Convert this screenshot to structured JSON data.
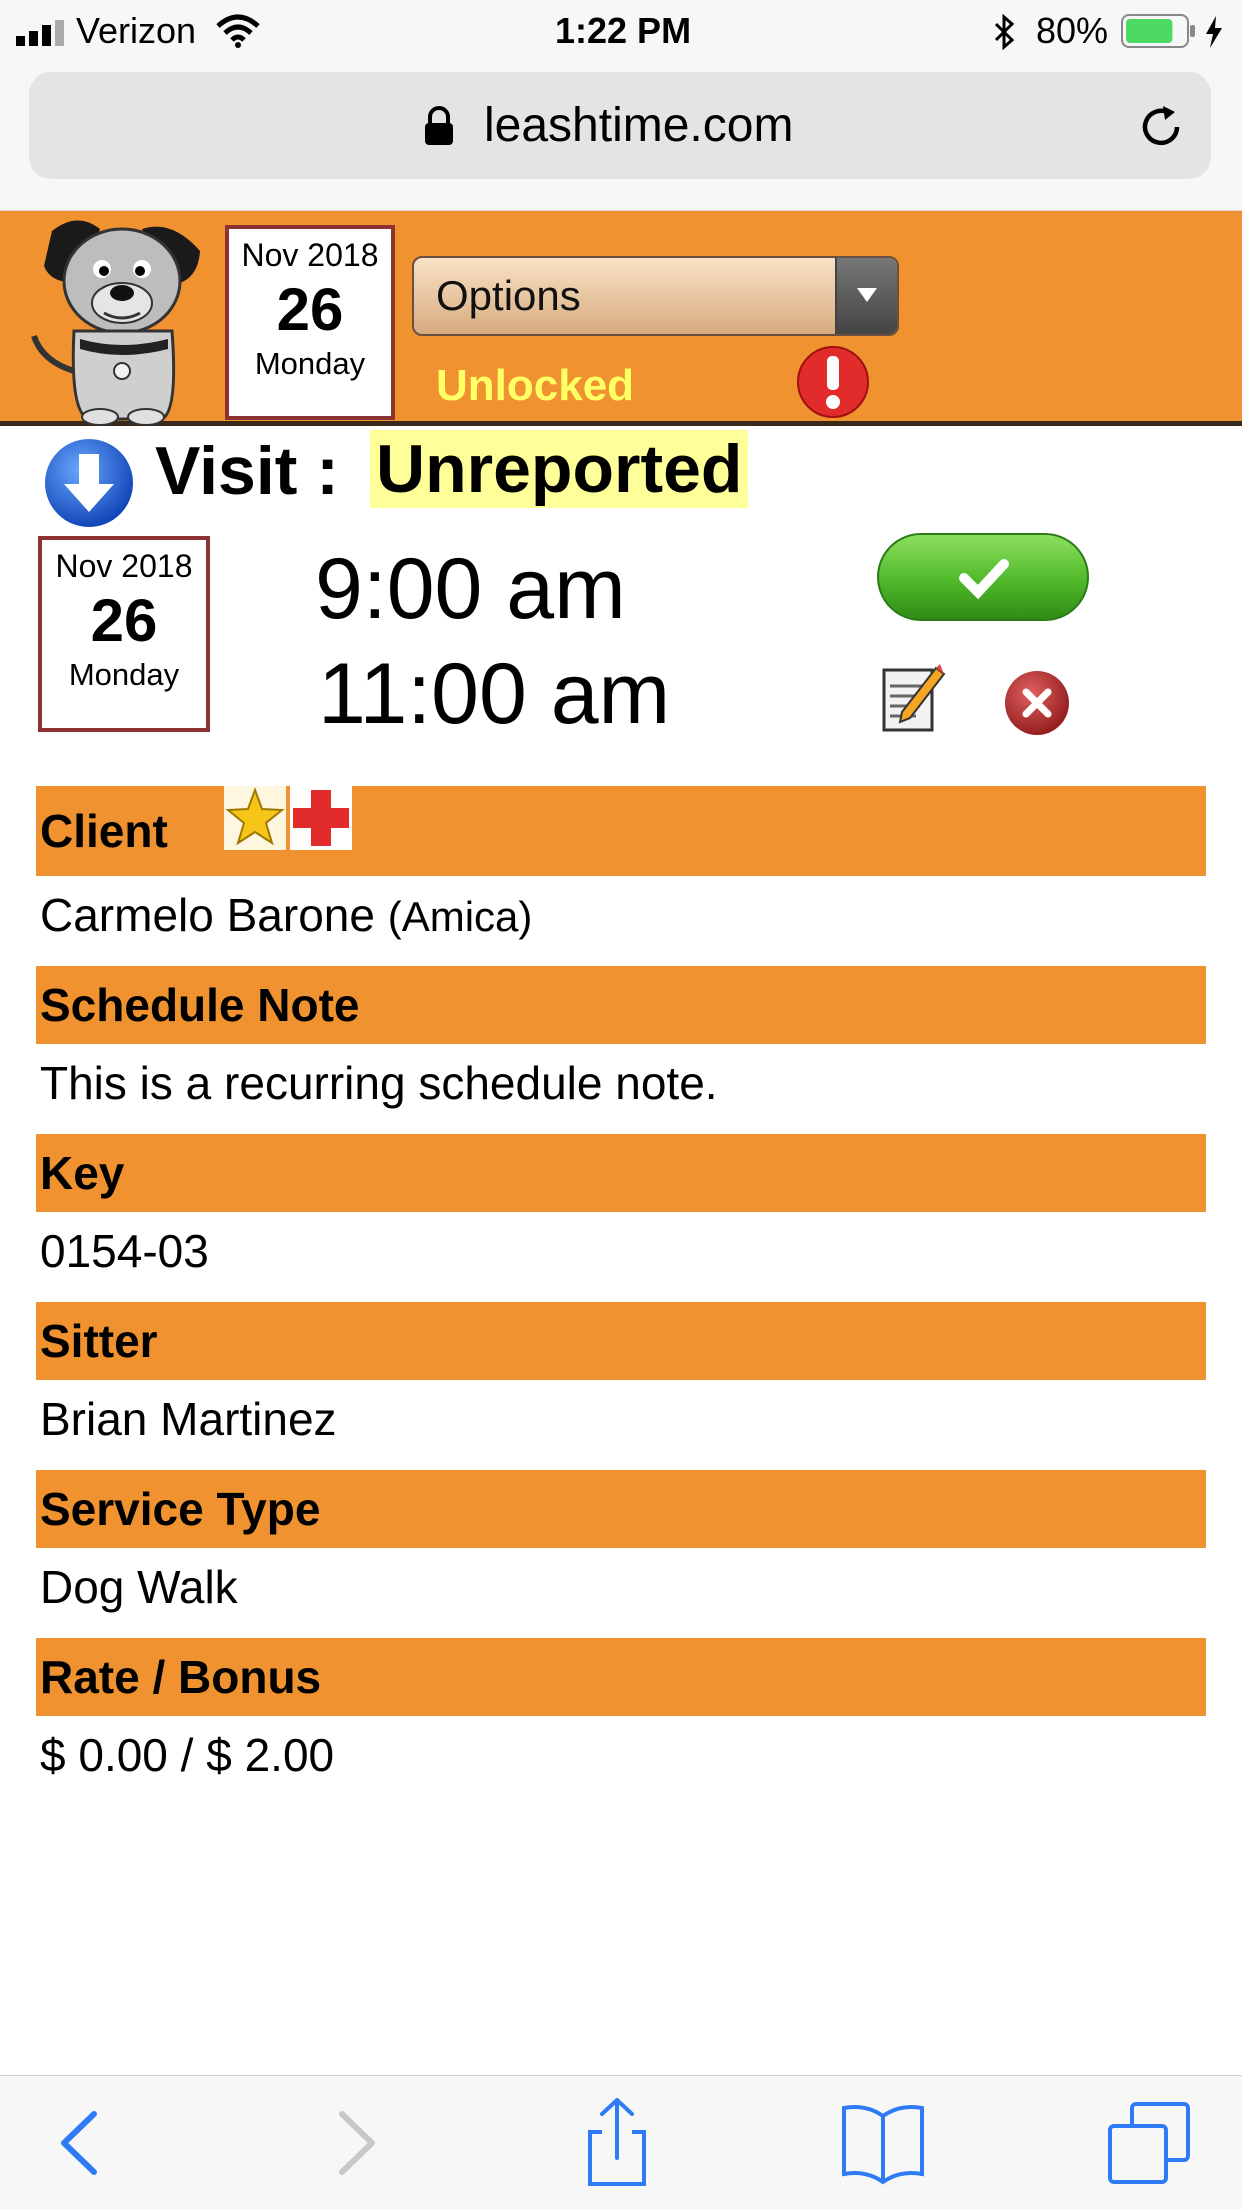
{
  "status_bar": {
    "carrier": "Verizon",
    "time": "1:22 PM",
    "battery": "80%",
    "battery_level": 0.8
  },
  "browser": {
    "url": "leashtime.com"
  },
  "header": {
    "date": {
      "month_year": "Nov 2018",
      "day": "26",
      "weekday": "Monday"
    },
    "options_label": "Options",
    "lock_status": "Unlocked"
  },
  "visit": {
    "label": "Visit :",
    "status": "Unreported",
    "date": {
      "month_year": "Nov 2018",
      "day": "26",
      "weekday": "Monday"
    },
    "start_time": "9:00 am",
    "end_time": "11:00 am"
  },
  "sections": {
    "client": {
      "label": "Client",
      "client_name": "Carmelo Barone",
      "pet_name": "(Amica)"
    },
    "schedule_note": {
      "label": "Schedule Note",
      "value": "This is a recurring schedule note."
    },
    "key": {
      "label": "Key",
      "value": "0154-03"
    },
    "sitter": {
      "label": "Sitter",
      "value": "Brian Martinez"
    },
    "service_type": {
      "label": "Service Type",
      "value": "Dog Walk"
    },
    "rate_bonus": {
      "label": "Rate / Bonus",
      "value": "$ 0.00 / $ 2.00"
    }
  },
  "colors": {
    "brand_orange": "#f0922f",
    "unlocked_yellow": "#ffff66",
    "highlight_yellow": "#ffff99",
    "date_border": "#8b3232",
    "ios_blue": "#2f7bf6"
  }
}
